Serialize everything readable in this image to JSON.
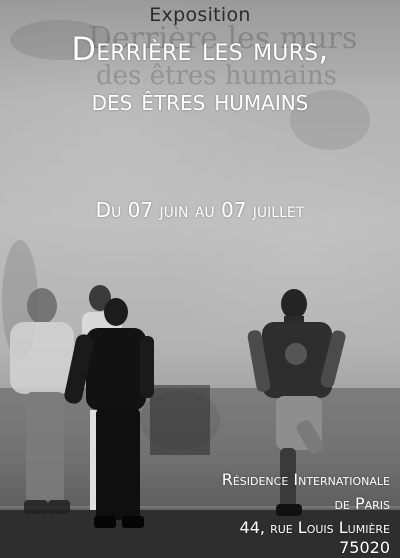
{
  "poster": {
    "kicker": "Exposition",
    "title_line1": "Derrière les murs,",
    "title_line2": "des êtres humains",
    "dates": "Du 07 juin au 07 juillet",
    "wall_graffiti": "Derrière les murs des êtres humains",
    "venue": {
      "line1": "Résidence Internationale",
      "line2": "de Paris",
      "line3": "44, rue Louis Lumière",
      "line4": "75020"
    }
  }
}
